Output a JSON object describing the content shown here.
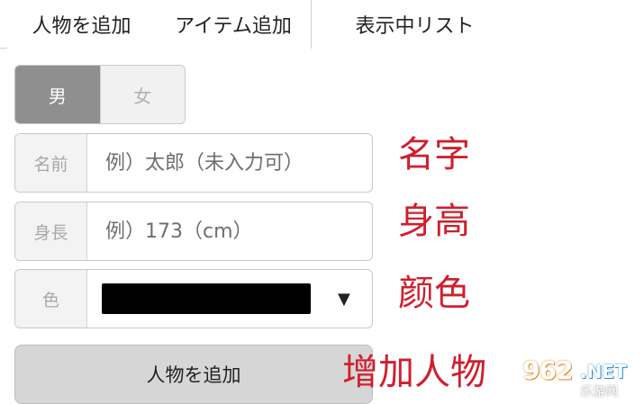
{
  "tabs": [
    {
      "label": "人物を追加",
      "active": true
    },
    {
      "label": "アイテム追加",
      "active": false
    },
    {
      "label": "表示中リスト",
      "active": false
    }
  ],
  "gender": {
    "male_label": "男",
    "female_label": "女",
    "selected": "男"
  },
  "form": {
    "name": {
      "label": "名前",
      "placeholder": "例）太郎（未入力可）"
    },
    "height": {
      "label": "身長",
      "placeholder": "例）173（cm）"
    },
    "color": {
      "label": "色",
      "selected_color": "#000000",
      "caret": "▼"
    }
  },
  "add_button_label": "人物を追加",
  "annotations": {
    "name": "名字",
    "height": "身高",
    "color": "颜色",
    "add": "增加人物"
  },
  "watermark": {
    "number": "962",
    "suffix": ".NET",
    "sub": "乐游网"
  },
  "colors": {
    "accent_red": "#cf1f2e",
    "selected_gender_bg": "#8f8f8f",
    "button_bg": "#d6d6d6"
  }
}
